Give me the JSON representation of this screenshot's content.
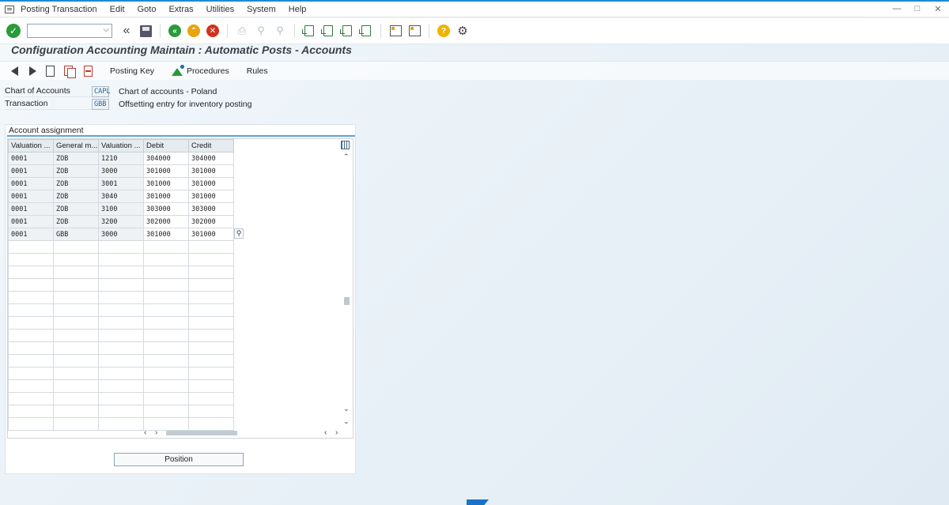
{
  "menu": {
    "items": [
      {
        "label": "Posting Transaction",
        "ul": "P"
      },
      {
        "label": "Edit",
        "ul": "E"
      },
      {
        "label": "Goto",
        "ul": "G"
      },
      {
        "label": "Extras",
        "ul": "x"
      },
      {
        "label": "Utilities",
        "ul": "U"
      },
      {
        "label": "System",
        "ul": "S"
      },
      {
        "label": "Help",
        "ul": "H"
      }
    ]
  },
  "toolbar": {
    "command_value": "",
    "icons": [
      "check-icon",
      "back-double-icon",
      "save-icon",
      "back-icon",
      "exit-icon",
      "cancel-icon",
      "print-icon",
      "find-icon",
      "find-next-icon",
      "first-page-icon",
      "previous-page-icon",
      "next-page-icon",
      "last-page-icon",
      "new-session-icon",
      "shortcut-icon",
      "help-icon",
      "settings-icon"
    ]
  },
  "title": "Configuration Accounting Maintain : Automatic Posts - Accounts",
  "app_toolbar": {
    "posting_key": "Posting Key",
    "procedures": "Procedures",
    "rules": "Rules"
  },
  "header": {
    "chart_of_accounts_label": "Chart of Accounts",
    "chart_of_accounts_value": "CAPL",
    "chart_of_accounts_desc": "Chart of accounts - Poland",
    "transaction_label": "Transaction",
    "transaction_value": "GBB",
    "transaction_desc": "Offsetting entry for inventory posting"
  },
  "assignment": {
    "title": "Account assignment",
    "columns": [
      "Valuation ...",
      "General m...",
      "Valuation ...",
      "Debit",
      "Credit"
    ],
    "rows": [
      [
        "0001",
        "ZOB",
        "1210",
        "304000",
        "304000"
      ],
      [
        "0001",
        "ZOB",
        "3000",
        "301000",
        "301000"
      ],
      [
        "0001",
        "ZOB",
        "3001",
        "301000",
        "301000"
      ],
      [
        "0001",
        "ZOB",
        "3040",
        "301000",
        "301000"
      ],
      [
        "0001",
        "ZOB",
        "3100",
        "303000",
        "303000"
      ],
      [
        "0001",
        "ZOB",
        "3200",
        "302000",
        "302000"
      ],
      [
        "0001",
        "GBB",
        "3000",
        "301000",
        "301000"
      ]
    ],
    "empty_rows": 15,
    "position_button": "Position"
  }
}
